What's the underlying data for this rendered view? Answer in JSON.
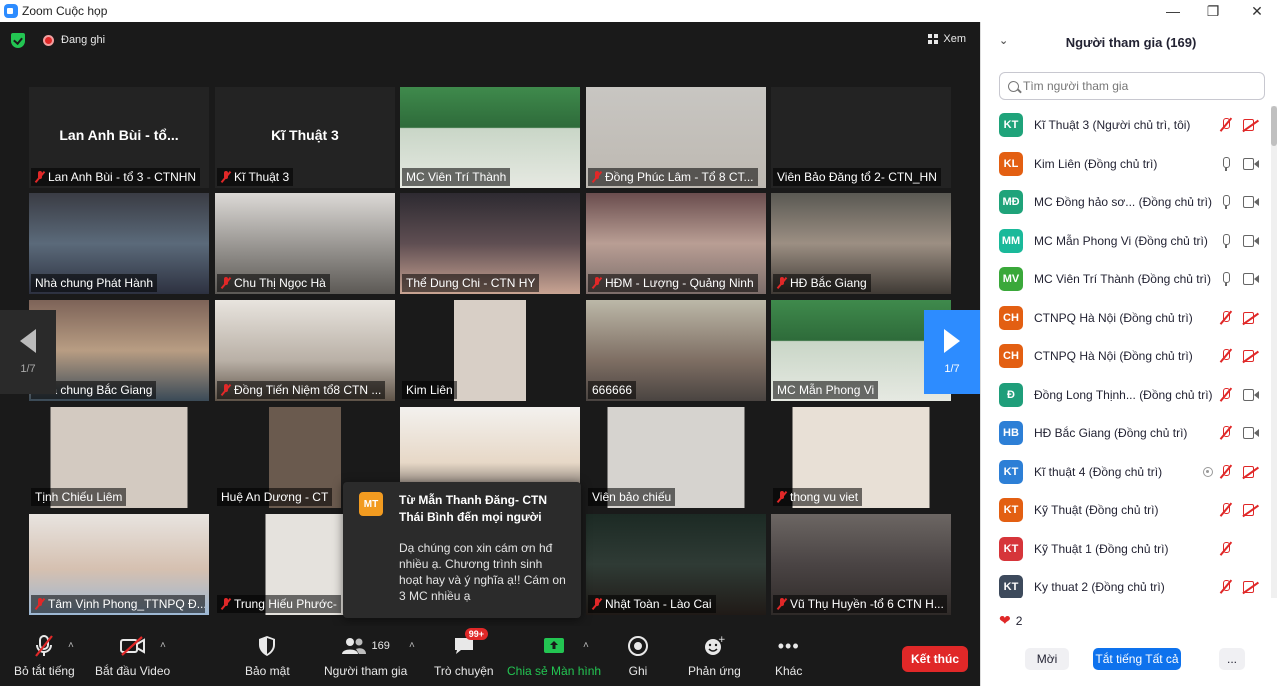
{
  "window": {
    "title": "Zoom Cuộc họp"
  },
  "topbar": {
    "recording_label": "Đang ghi",
    "view_label": "Xem"
  },
  "tiles": [
    {
      "name": "Lan Anh Bùi - tổ 3 - CTNHN",
      "center": "Lan Anh Bùi - tổ...",
      "muted": true
    },
    {
      "name": "Kĩ Thuật 3",
      "center": "Kĩ Thuật 3",
      "muted": true
    },
    {
      "name": "MC Viên Trí Thành",
      "muted": false
    },
    {
      "name": "Đồng Phúc Lâm - Tổ 8 CT...",
      "muted": true
    },
    {
      "name": "Viên Bảo Đăng tổ 2- CTN_HN",
      "muted": false
    },
    {
      "name": "Nhà chung Phát Hành",
      "muted": false,
      "active": true
    },
    {
      "name": "Chu Thị Ngọc Hà",
      "muted": true
    },
    {
      "name": "Thể Dung Chi - CTN HY",
      "muted": false
    },
    {
      "name": "HĐM - Lượng - Quảng Ninh",
      "muted": true
    },
    {
      "name": "HĐ Bắc Giang",
      "muted": true
    },
    {
      "name": "Nhà chung Bắc Giang",
      "muted": false
    },
    {
      "name": "Đồng Tiến Niệm tổ8 CTN ...",
      "muted": true
    },
    {
      "name": "Kim Liên",
      "muted": false
    },
    {
      "name": "666666",
      "muted": false
    },
    {
      "name": "MC Mẫn Phong Vi",
      "muted": false
    },
    {
      "name": "Tịnh Chiếu Liêm",
      "muted": false
    },
    {
      "name": "Huệ An Dương - CT",
      "muted": false
    },
    {
      "name": "",
      "muted": false
    },
    {
      "name": "Viên bảo chiếu",
      "muted": false
    },
    {
      "name": "thong vu viet",
      "muted": true
    },
    {
      "name": "Tâm Vịnh Phong_TTNPQ Đ...",
      "muted": true
    },
    {
      "name": "Trung Hiếu Phước- ",
      "muted": true
    },
    {
      "name": "",
      "muted": false
    },
    {
      "name": "Nhật Toàn - Lào Cai",
      "muted": true
    },
    {
      "name": "Vũ Thụ Huyền -tổ 6 CTN H...",
      "muted": true
    }
  ],
  "pager": {
    "left": "1/7",
    "right": "1/7"
  },
  "chat_popup": {
    "avatar": "MT",
    "from": "Từ Mẫn Thanh Đăng- CTN Thái Bình đến mọi người",
    "message": "Dạ chúng con xin cám ơn hđ nhiều ạ. Chương trình sinh hoạt hay và ý nghĩa ạ!! Cám on 3 MC nhiều ạ"
  },
  "toolbar": {
    "mute_all": "Bỏ tắt tiếng",
    "start_video": "Bắt đầu Video",
    "security": "Bảo mật",
    "participants": "Người tham gia",
    "participants_count": "169",
    "chat": "Trò chuyện",
    "chat_badge": "99+",
    "share": "Chia sẻ Màn hình",
    "record": "Ghi",
    "reactions": "Phản ứng",
    "more": "Khác",
    "end": "Kết thúc",
    "share_color": "#23c552",
    "end_color": "#e02828"
  },
  "panel": {
    "title": "Người tham gia (169)",
    "search_placeholder": "Tìm người tham gia",
    "participants": [
      {
        "initials": "KT",
        "color": "#1fa37a",
        "name": "Kĩ Thuật 3 (Người chủ trì, tôi)",
        "mic": "off",
        "cam": "off"
      },
      {
        "initials": "KL",
        "color": "#e35f12",
        "name": "Kim Liên (Đồng chủ trì)",
        "mic": "on",
        "cam": "on"
      },
      {
        "initials": "MĐ",
        "color": "#1fa37a",
        "name": "MC Đồng hảo sơ... (Đồng chủ trì)",
        "mic": "on",
        "cam": "on"
      },
      {
        "initials": "MM",
        "color": "#1ab99a",
        "name": "MC Mẫn Phong Vi (Đồng chủ trì)",
        "mic": "on",
        "cam": "on"
      },
      {
        "initials": "MV",
        "color": "#3aa83a",
        "name": "MC Viên Trí Thành (Đồng chủ trì)",
        "mic": "on",
        "cam": "on"
      },
      {
        "initials": "CH",
        "color": "#e35f12",
        "name": "CTNPQ Hà Nội (Đồng chủ trì)",
        "mic": "off",
        "cam": "off"
      },
      {
        "initials": "CH",
        "color": "#e35f12",
        "name": "CTNPQ Hà Nội (Đồng chủ trì)",
        "mic": "off",
        "cam": "off"
      },
      {
        "initials": "Đ",
        "color": "#1f9e7a",
        "name": "Đồng Long Thịnh... (Đồng chủ trì)",
        "mic": "off",
        "cam": "on"
      },
      {
        "initials": "HB",
        "color": "#2d7fd6",
        "name": "HĐ Bắc Giang (Đồng chủ trì)",
        "mic": "off",
        "cam": "on"
      },
      {
        "initials": "KT",
        "color": "#2d7fd6",
        "name": "Kĩ thuật 4 (Đồng chủ trì)",
        "mic": "off",
        "cam": "off",
        "rec": true
      },
      {
        "initials": "KT",
        "color": "#e35f12",
        "name": "Kỹ Thuật (Đồng chủ trì)",
        "mic": "off",
        "cam": "off"
      },
      {
        "initials": "KT",
        "color": "#d6353a",
        "name": "Kỹ Thuật 1 (Đồng chủ trì)",
        "mic": "off",
        "cam": "none"
      },
      {
        "initials": "KT",
        "color": "#3d4a5c",
        "name": "Ky thuat 2 (Đồng chủ trì)",
        "mic": "off",
        "cam": "off"
      }
    ],
    "reaction_count": "2",
    "invite": "Mời",
    "mute_all": "Tắt tiếng Tất cả",
    "more": "...",
    "accent_color": "#0e72ed"
  }
}
